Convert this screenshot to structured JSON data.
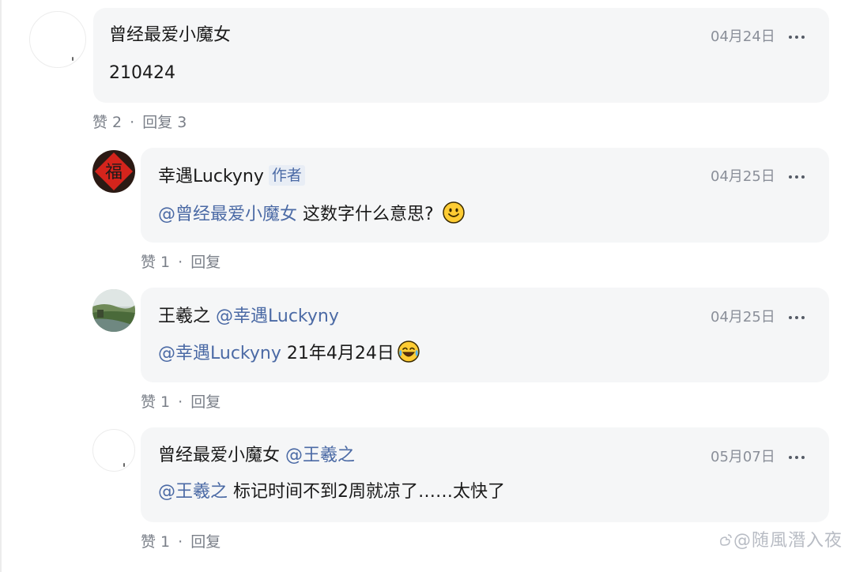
{
  "comments": [
    {
      "author": "曾经最爱小魔女",
      "date": "04月24日",
      "text": "210424",
      "likes_label": "赞 2",
      "reply_label": "回复 3"
    },
    {
      "author": "幸遇Luckyny",
      "author_tag": "作者",
      "date": "04月25日",
      "mention": "@曾经最爱小魔女",
      "text": "这数字什么意思?",
      "emoji": "smiley-emoji",
      "likes_label": "赞 1",
      "reply_label": "回复"
    },
    {
      "author": "王羲之",
      "reply_to": "@幸遇Luckyny",
      "date": "04月25日",
      "mention": "@幸遇Luckyny",
      "text": "21年4月24日",
      "emoji": "tears-of-joy-emoji",
      "likes_label": "赞 1",
      "reply_label": "回复"
    },
    {
      "author": "曾经最爱小魔女",
      "reply_to": "@王羲之",
      "date": "05月07日",
      "mention": "@王羲之",
      "text": "标记时间不到2周就凉了……太快了",
      "likes_label": "赞 1",
      "reply_label": "回复"
    }
  ],
  "separator": "·",
  "watermark": "@随風潛入夜",
  "colors": {
    "mention": "#4b6aa5",
    "bubble": "#f5f6f7",
    "meta": "#8a8f99"
  }
}
